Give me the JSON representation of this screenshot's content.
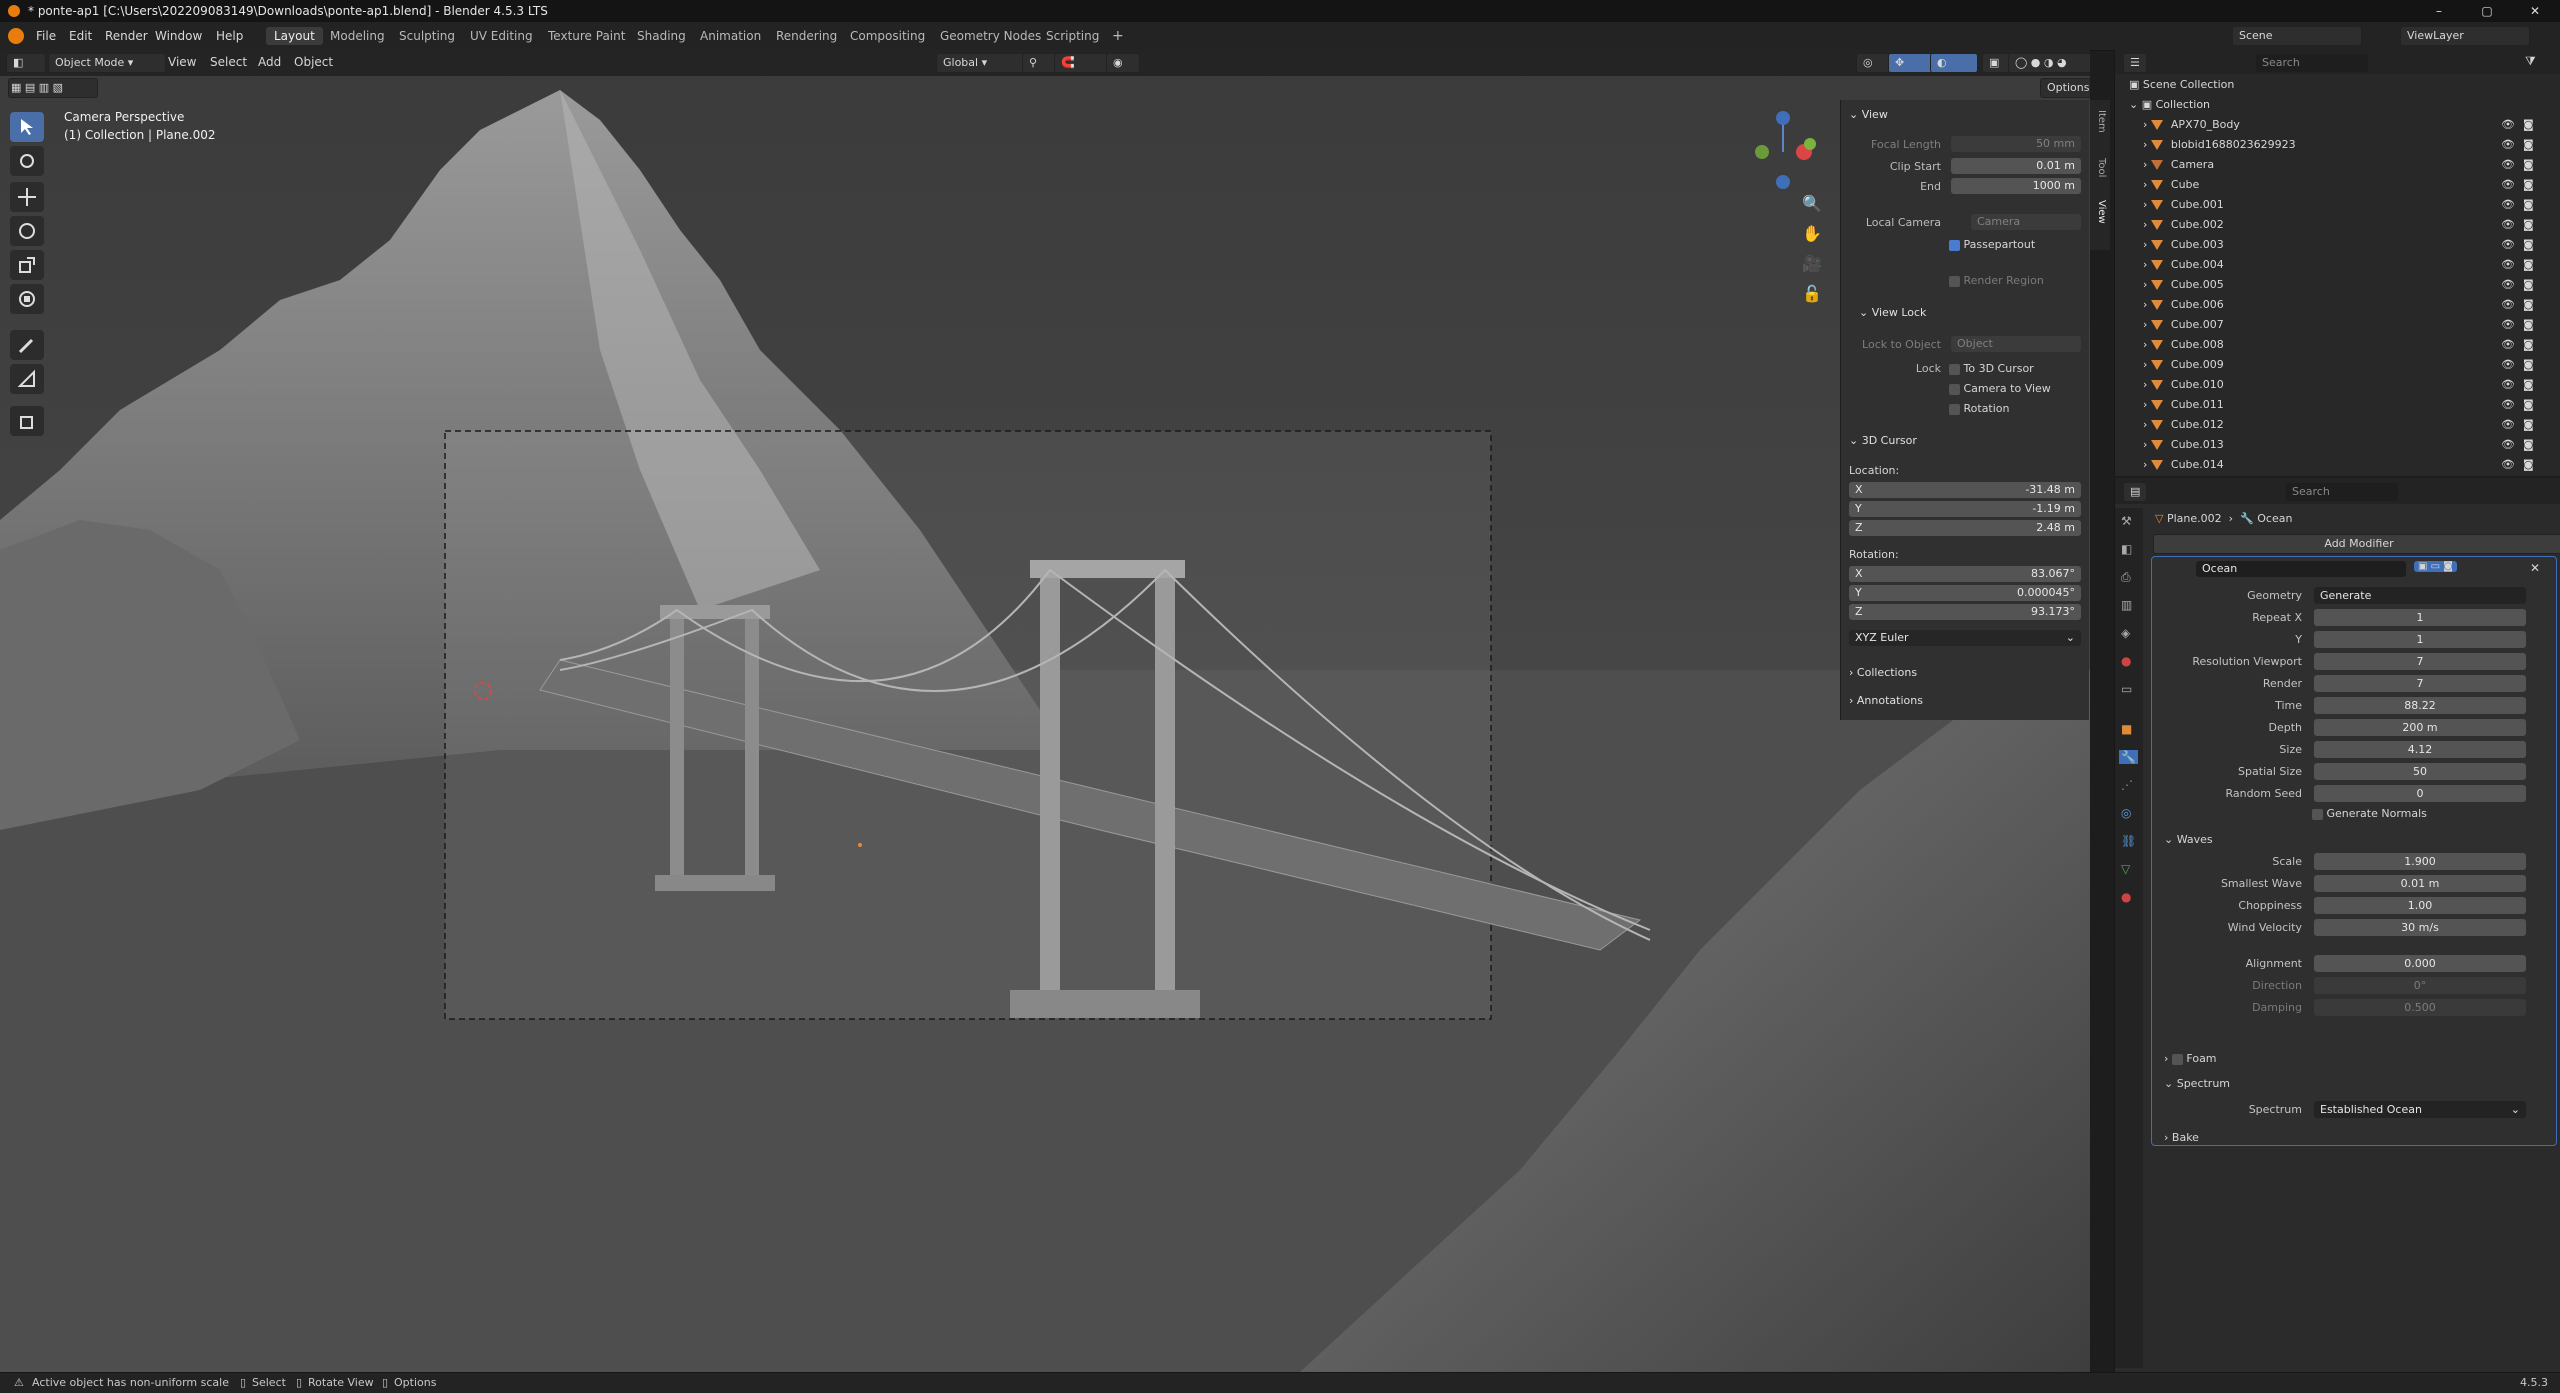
{
  "titlebar": {
    "title": "* ponte-ap1 [C:\\Users\\202209083149\\Downloads\\ponte-ap1.blend] - Blender 4.5.3 LTS",
    "minimize": "–",
    "maximize": "▢",
    "close": "✕"
  },
  "menu": [
    "File",
    "Edit",
    "Render",
    "Window",
    "Help"
  ],
  "workspaces": [
    {
      "label": "Layout",
      "active": true
    },
    {
      "label": "Modeling"
    },
    {
      "label": "Sculpting"
    },
    {
      "label": "UV Editing"
    },
    {
      "label": "Texture Paint"
    },
    {
      "label": "Shading"
    },
    {
      "label": "Animation"
    },
    {
      "label": "Rendering"
    },
    {
      "label": "Compositing"
    },
    {
      "label": "Geometry Nodes"
    },
    {
      "label": "Scripting"
    }
  ],
  "top_right": {
    "scene": "Scene",
    "view_layer": "ViewLayer"
  },
  "viewport_header": {
    "mode": "Object Mode",
    "menus": [
      "View",
      "Select",
      "Add",
      "Object"
    ],
    "transform": "Global",
    "options": "Options"
  },
  "viewport_overlay": {
    "line1": "Camera Perspective",
    "line2": "(1) Collection | Plane.002"
  },
  "npanel": {
    "view": {
      "title": "View",
      "focal_length_label": "Focal Length",
      "focal_length": "50 mm",
      "clip_start_label": "Clip Start",
      "clip_start": "0.01 m",
      "end_label": "End",
      "end": "1000 m",
      "local_camera_label": "Local Camera",
      "local_camera": "Camera",
      "passepartout": "Passepartout",
      "render_region": "Render Region"
    },
    "view_lock": {
      "title": "View Lock",
      "lock_to_object_label": "Lock to Object",
      "lock_to_object": "Object",
      "lock_label": "Lock",
      "to_3d_cursor": "To 3D Cursor",
      "camera_to_view": "Camera to View",
      "rotation": "Rotation"
    },
    "cursor": {
      "title": "3D Cursor",
      "location_label": "Location:",
      "lx": "-31.48 m",
      "ly": "-1.19 m",
      "lz": "2.48 m",
      "rotation_label": "Rotation:",
      "rx": "83.067°",
      "ry": "0.000045°",
      "rz": "93.173°",
      "mode": "XYZ Euler"
    },
    "collections": "Collections",
    "annotations": "Annotations",
    "tabs": [
      "Item",
      "Tool",
      "View"
    ]
  },
  "outliner": {
    "search_placeholder": "Search",
    "scene_collection": "Scene Collection",
    "collection": "Collection",
    "items": [
      "APX70_Body",
      "blobid1688023629923",
      "Camera",
      "Cube",
      "Cube.001",
      "Cube.002",
      "Cube.003",
      "Cube.004",
      "Cube.005",
      "Cube.006",
      "Cube.007",
      "Cube.008",
      "Cube.009",
      "Cube.010",
      "Cube.011",
      "Cube.012",
      "Cube.013",
      "Cube.014"
    ]
  },
  "properties": {
    "search_placeholder": "Search",
    "breadcrumb_object": "Plane.002",
    "breadcrumb_modifier": "Ocean",
    "add_modifier": "Add Modifier",
    "modifier_name": "Ocean",
    "fields": [
      {
        "label": "Geometry",
        "value": "Generate"
      },
      {
        "label": "Repeat X",
        "value": "1"
      },
      {
        "label": "Y",
        "value": "1"
      },
      {
        "label": "Resolution Viewport",
        "value": "7"
      },
      {
        "label": "Render",
        "value": "7"
      },
      {
        "label": "Time",
        "value": "88.22"
      },
      {
        "label": "Depth",
        "value": "200 m"
      },
      {
        "label": "Size",
        "value": "4.12"
      },
      {
        "label": "Spatial Size",
        "value": "50"
      },
      {
        "label": "Random Seed",
        "value": "0"
      }
    ],
    "generate_normals": "Generate Normals",
    "waves_title": "Waves",
    "waves": [
      {
        "label": "Scale",
        "value": "1.900"
      },
      {
        "label": "Smallest Wave",
        "value": "0.01 m"
      },
      {
        "label": "Choppiness",
        "value": "1.00"
      },
      {
        "label": "Wind Velocity",
        "value": "30 m/s"
      },
      {
        "label": "Alignment",
        "value": "0.000"
      },
      {
        "label": "Direction",
        "value": "0°"
      },
      {
        "label": "Damping",
        "value": "0.500"
      }
    ],
    "foam": "Foam",
    "spectrum_title": "Spectrum",
    "spectrum_label": "Spectrum",
    "spectrum_value": "Established Ocean",
    "bake": "Bake"
  },
  "statusbar": {
    "warning": "Active object has non-uniform scale",
    "select": "Select",
    "rotate": "Rotate View",
    "options": "Options",
    "version": "4.5.3"
  }
}
